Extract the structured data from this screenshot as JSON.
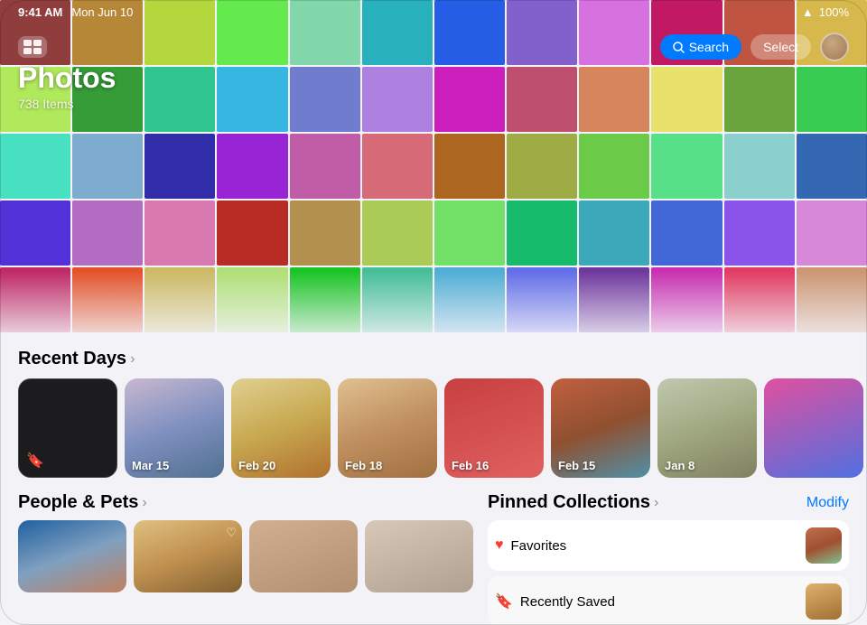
{
  "statusBar": {
    "time": "9:41 AM",
    "date": "Mon Jun 10",
    "battery": "100%",
    "batteryIcon": "🔋"
  },
  "toolbar": {
    "gridIcon": "⊞",
    "searchLabel": "Search",
    "selectLabel": "Select"
  },
  "photosHeader": {
    "title": "Photos",
    "count": "738 Items"
  },
  "recentDays": {
    "title": "Recent Days",
    "chevron": "›",
    "items": [
      {
        "label": "",
        "isSpecial": true,
        "colorClass": "day-special"
      },
      {
        "label": "Mar 15",
        "colorClass": "day-c2"
      },
      {
        "label": "Feb 20",
        "colorClass": "day-c3"
      },
      {
        "label": "Feb 18",
        "colorClass": "day-c4"
      },
      {
        "label": "Feb 16",
        "colorClass": "day-c5"
      },
      {
        "label": "Feb 15",
        "colorClass": "day-c6"
      },
      {
        "label": "Jan 8",
        "colorClass": "day-c7"
      },
      {
        "label": "",
        "colorClass": "day-c8"
      }
    ]
  },
  "peopleAndPets": {
    "title": "People & Pets",
    "chevron": "›",
    "items": [
      {
        "colorClass": "person-c1",
        "hasHeart": false
      },
      {
        "colorClass": "person-c2",
        "hasHeart": true
      },
      {
        "colorClass": "person-c3",
        "hasHeart": false
      },
      {
        "colorClass": "person-c4",
        "hasHeart": false
      }
    ]
  },
  "pinnedCollections": {
    "title": "Pinned Collections",
    "chevron": "›",
    "modifyLabel": "Modify",
    "items": [
      {
        "icon": "♥",
        "label": "Favorites",
        "thumbClass": "fav-thumb"
      },
      {
        "icon": "🔖",
        "label": "Recently Saved",
        "thumbClass": "saved-thumb"
      }
    ]
  },
  "photoGrid": {
    "colors": [
      "c1",
      "c2",
      "c3",
      "c4",
      "c5",
      "c6",
      "c7",
      "c8",
      "c9",
      "c10",
      "c11",
      "c12",
      "c13",
      "c14",
      "c15",
      "c1",
      "c2",
      "c3",
      "c4",
      "c5",
      "c6",
      "c7",
      "c8",
      "c9",
      "c10",
      "c11",
      "c12",
      "c13",
      "c14",
      "c15",
      "c1",
      "c2",
      "c3",
      "c4",
      "c5",
      "c6",
      "c7",
      "c8",
      "c9",
      "c10",
      "c11",
      "c12",
      "c13",
      "c14",
      "c15",
      "c1",
      "c2",
      "c3",
      "c4",
      "c5",
      "c6",
      "c7",
      "c8",
      "c9",
      "c10",
      "c11",
      "c12"
    ]
  }
}
